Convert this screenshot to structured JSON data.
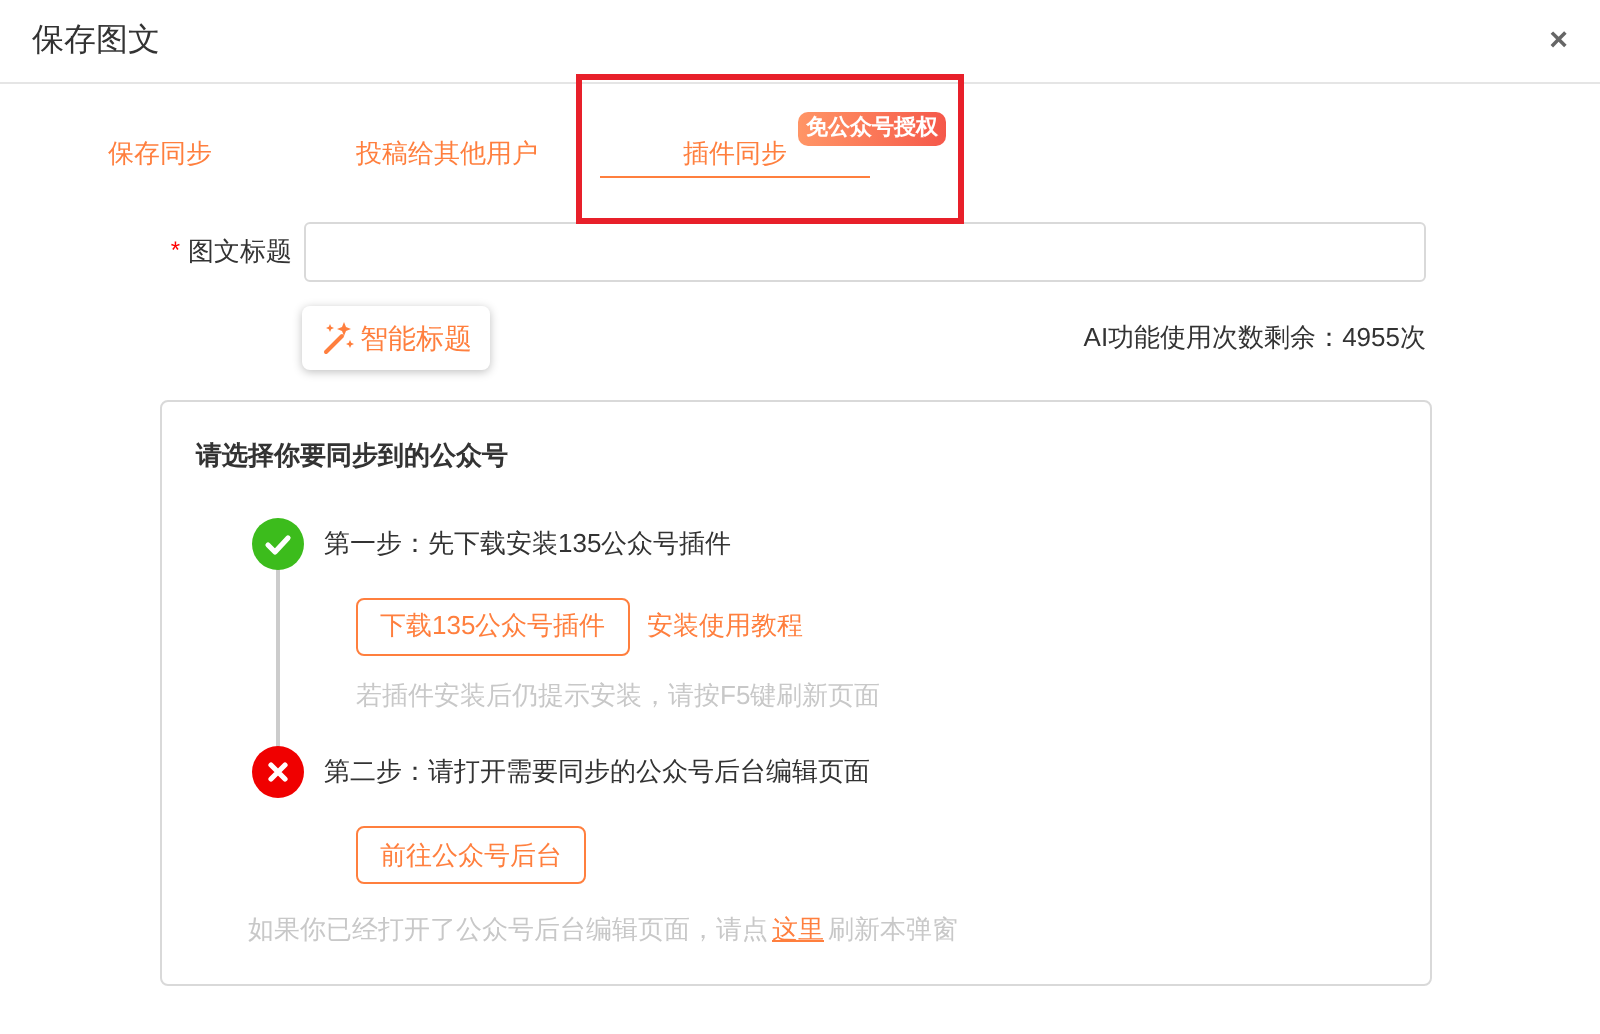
{
  "dialog": {
    "title": "保存图文",
    "close": "×"
  },
  "tabs": [
    {
      "label": "保存同步",
      "selected": false
    },
    {
      "label": "投稿给其他用户",
      "selected": false
    },
    {
      "label": "插件同步",
      "selected": true,
      "badge": "免公众号授权",
      "highlighted": true
    }
  ],
  "form": {
    "title_label": "图文标题",
    "required_mark": "*",
    "ai_button": "智能标题",
    "ai_quota": "AI功能使用次数剩余：4955次"
  },
  "sync_panel": {
    "heading": "请选择你要同步到的公众号",
    "steps": [
      {
        "kind": "done",
        "text": "第一步：先下载安装135公众号插件",
        "button": "下载135公众号插件",
        "link": "安装使用教程",
        "hint": "若插件安装后仍提示安装，请按F5键刷新页面"
      },
      {
        "kind": "error",
        "text": "第二步：请打开需要同步的公众号后台编辑页面",
        "button": "前往公众号后台"
      }
    ],
    "footer_before": "如果你已经打开了公众号后台编辑页面，请点",
    "footer_link": "这里",
    "footer_after": "刷新本弹窗"
  }
}
